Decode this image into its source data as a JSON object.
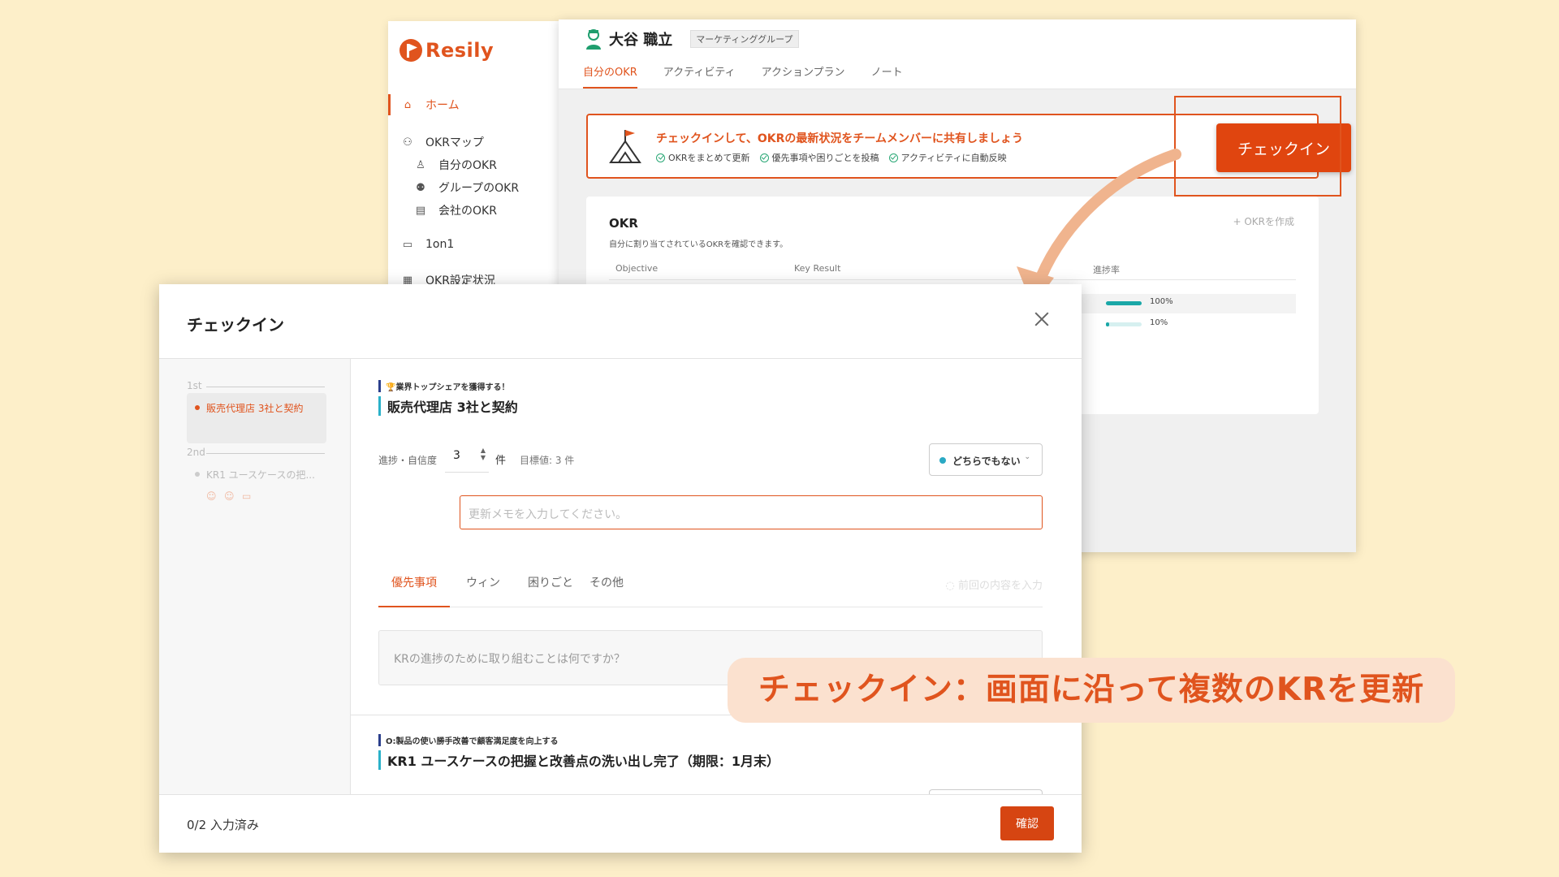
{
  "app": {
    "logo": "Resily",
    "brand_color": "#e0541e",
    "sidebar": [
      {
        "label": "ホーム",
        "icon": "home-icon",
        "active": true
      },
      {
        "label": "OKRマップ",
        "icon": "map-icon"
      },
      {
        "label": "自分のOKR",
        "icon": "user-icon"
      },
      {
        "label": "グループのOKR",
        "icon": "group-icon"
      },
      {
        "label": "会社のOKR",
        "icon": "building-icon"
      },
      {
        "label": "1on1",
        "icon": "chat-icon"
      },
      {
        "label": "OKR設定状況",
        "icon": "settings-status-icon"
      }
    ],
    "user": {
      "name": "大谷 職立",
      "group": "マーケティンググループ"
    },
    "tabs": [
      "自分のOKR",
      "アクティビティ",
      "アクションプラン",
      "ノート"
    ],
    "banner": {
      "title": "チェックインして、OKRの最新状況をチームメンバーに共有しましょう",
      "points": [
        "OKRをまとめて更新",
        "優先事項や困りごとを投稿",
        "アクティビティに自動反映"
      ],
      "button": "チェックイン"
    },
    "okr_card": {
      "title": "OKR",
      "subtitle": "自分に割り当てされているOKRを確認できます。",
      "create": "+ OKRを作成",
      "headers": [
        "Objective",
        "Key Result",
        "進捗率"
      ],
      "rows": [
        {
          "progress": 100,
          "label": "100%"
        },
        {
          "progress": 10,
          "label": "10%"
        }
      ]
    }
  },
  "modal": {
    "title": "チェックイン",
    "steps": [
      {
        "label": "1st",
        "item": "販売代理店 3社と契約",
        "active": true
      },
      {
        "label": "2nd",
        "item": "KR1 ユースケースの把..."
      }
    ],
    "kr1": {
      "objective": "🏆業界トップシェアを獲得する！",
      "title": "販売代理店 3社と契約",
      "field_label": "進捗・自信度",
      "value": "3",
      "unit": "件",
      "target": "目標値: 3 件",
      "status": "どちらでもない",
      "memo_placeholder": "更新メモを入力してください。"
    },
    "tabs": [
      "優先事項",
      "ウィン",
      "困りごと",
      "その他"
    ],
    "prev_fill": "前回の内容を入力",
    "textarea_placeholder": "KRの進捗のために取り組むことは何ですか？",
    "kr2": {
      "objective": "O:製品の使い勝手改善で顧客満足度を向上する",
      "title": "KR1 ユースケースの把握と改善点の洗い出し完了（期限：1月末）"
    },
    "footer": {
      "count": "0/2 入力済み",
      "confirm": "確認"
    }
  },
  "caption": "チェックイン：画面に沿って複数のKRを更新"
}
